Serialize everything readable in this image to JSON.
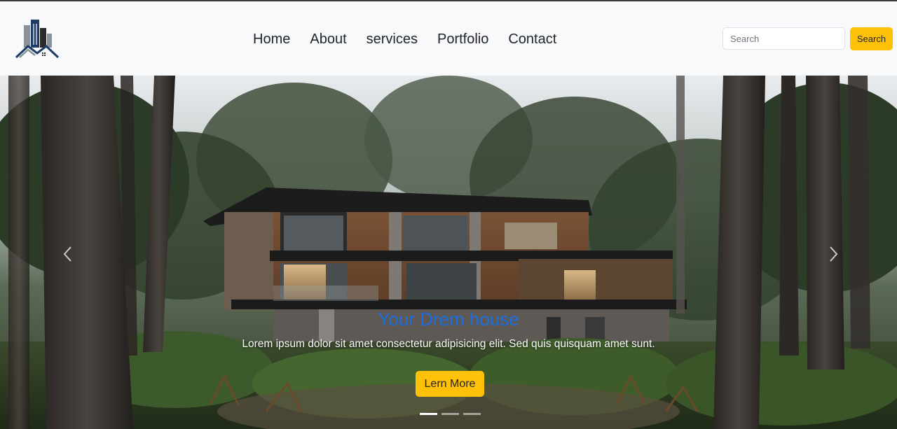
{
  "navbar": {
    "links": [
      "Home",
      "About",
      "services",
      "Portfolio",
      "Contact"
    ],
    "search": {
      "placeholder": "Search",
      "button_label": "Search"
    }
  },
  "hero": {
    "title": "Your Drem house",
    "text": "Lorem ipsum dolor sit amet consectetur adipisicing elit. Sed quis quisquam amet sunt.",
    "button_label": "Lern More",
    "slides_count": 3,
    "active_slide": 1
  },
  "colors": {
    "accent": "#ffc107",
    "title_blue": "#1a6fe0",
    "navbar_bg": "#f8f9fa"
  },
  "icons": [
    "building-logo-icon",
    "chevron-left-icon",
    "chevron-right-icon"
  ]
}
